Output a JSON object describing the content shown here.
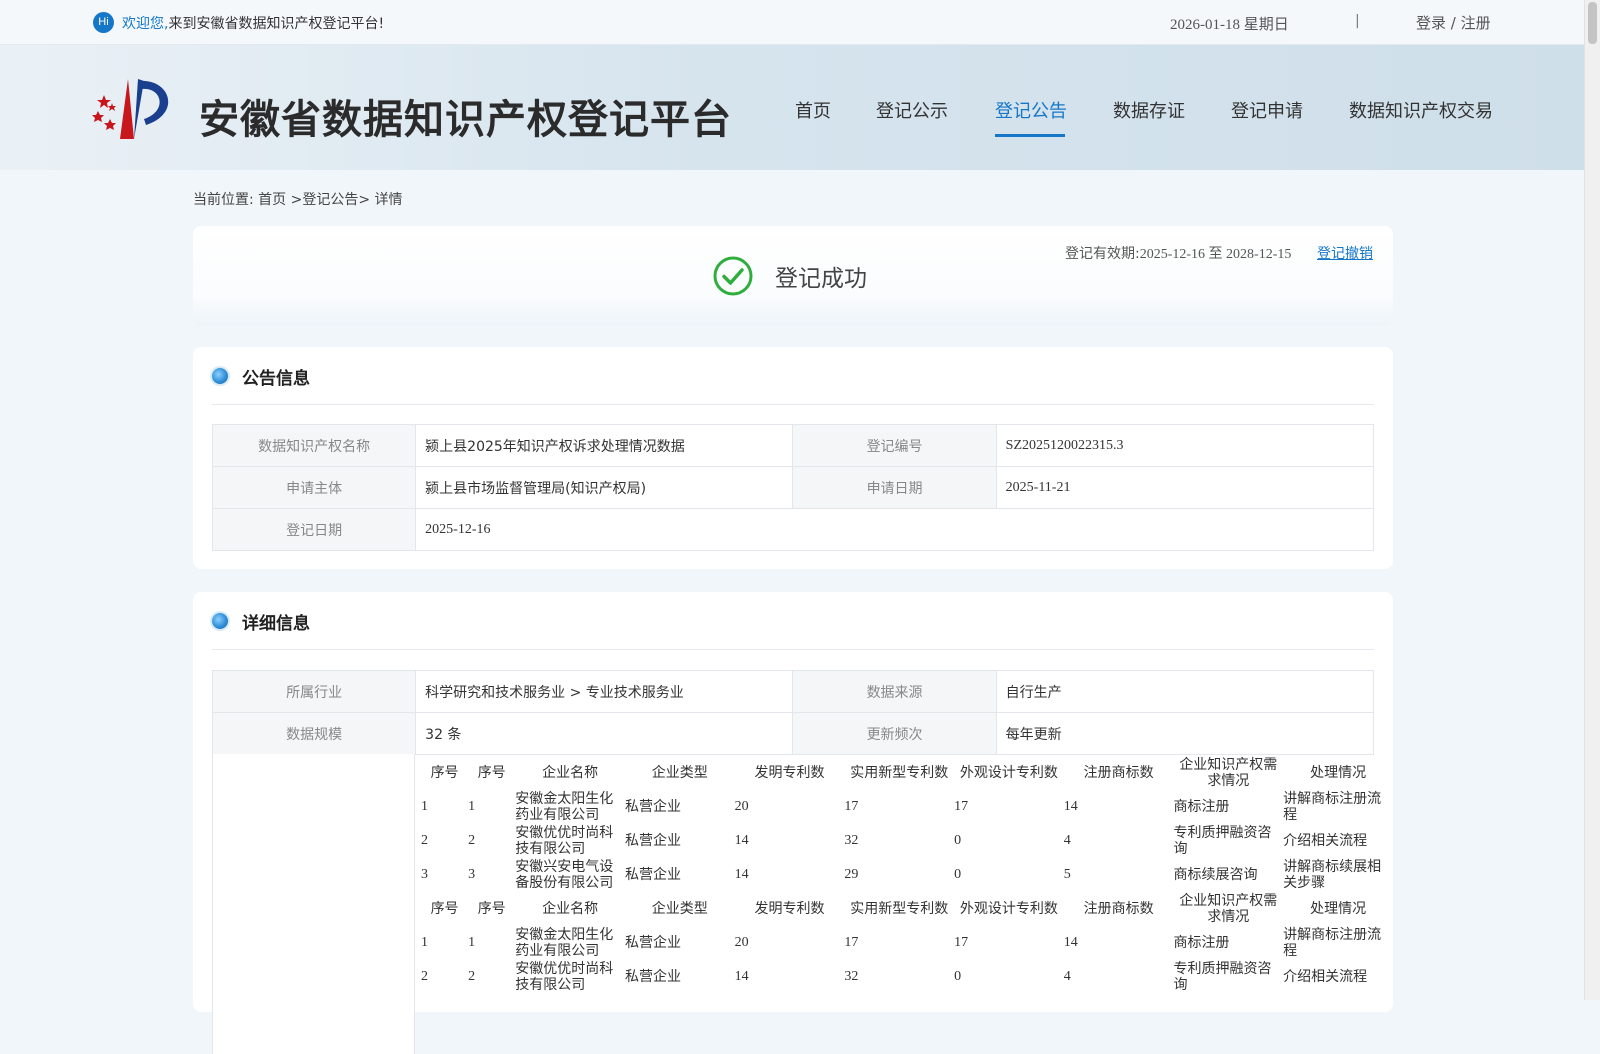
{
  "topbar": {
    "hi": "Hi",
    "welcome_accent": "欢迎您,",
    "welcome_rest": "来到安徽省数据知识产权登记平台!",
    "date": "2026-01-18 星期日",
    "separator": "|",
    "login": "登录",
    "slash": "/",
    "register": "注册"
  },
  "header": {
    "site_title": "安徽省数据知识产权登记平台",
    "nav": [
      "首页",
      "登记公示",
      "登记公告",
      "数据存证",
      "登记申请",
      "数据知识产权交易"
    ],
    "active_nav": "登记公告"
  },
  "breadcrumb": {
    "prefix": "当前位置:",
    "home": "首页",
    "sep1": ">",
    "section": "登记公告",
    "sep2": ">",
    "current": "详情"
  },
  "status": {
    "text": "登记成功",
    "validity_label": "登记有效期:",
    "validity_value": "2025-12-16 至 2028-12-15",
    "revoke": "登记撤销"
  },
  "announcement": {
    "title": "公告信息",
    "rows": [
      {
        "k1": "数据知识产权名称",
        "v1": "颍上县2025年知识产权诉求处理情况数据",
        "k2": "登记编号",
        "v2": "SZ2025120022315.3"
      },
      {
        "k1": "申请主体",
        "v1": "颍上县市场监督管理局(知识产权局)",
        "k2": "申请日期",
        "v2": "2025-11-21"
      },
      {
        "k1": "登记日期",
        "v1": "2025-12-16"
      }
    ]
  },
  "details": {
    "title": "详细信息",
    "rows": [
      {
        "k1": "所属行业",
        "v1": "科学研究和技术服务业 > 专业技术服务业",
        "k2": "数据来源",
        "v2": "自行生产"
      },
      {
        "k1": "数据规模",
        "v1": "32 条",
        "k2": "更新频次",
        "v2": "每年更新"
      }
    ],
    "headers": [
      "序号",
      "序号",
      "企业名称",
      "企业类型",
      "发明专利数",
      "实用新型专利数",
      "外观设计专利数",
      "注册商标数",
      "企业知识产权需求情况",
      "处理情况"
    ],
    "sample_rows": [
      [
        "1",
        "1",
        "安徽金太阳生化药业有限公司",
        "私营企业",
        "20",
        "17",
        "17",
        "14",
        "商标注册",
        "讲解商标注册流程"
      ],
      [
        "2",
        "2",
        "安徽优优时尚科技有限公司",
        "私营企业",
        "14",
        "32",
        "0",
        "4",
        "专利质押融资咨询",
        "介绍相关流程"
      ],
      [
        "3",
        "3",
        "安徽兴安电气设备股份有限公司",
        "私营企业",
        "14",
        "29",
        "0",
        "5",
        "商标续展咨询",
        "讲解商标续展相关步骤"
      ]
    ],
    "sample_rows_2": [
      [
        "1",
        "1",
        "安徽金太阳生化药业有限公司",
        "私营企业",
        "20",
        "17",
        "17",
        "14",
        "商标注册",
        "讲解商标注册流程"
      ],
      [
        "2",
        "2",
        "安徽优优时尚科技有限公司",
        "私营企业",
        "14",
        "32",
        "0",
        "4",
        "专利质押融资咨询",
        "介绍相关流程"
      ]
    ]
  },
  "colors": {
    "accent": "#1677c9",
    "success": "#2fae3e"
  }
}
